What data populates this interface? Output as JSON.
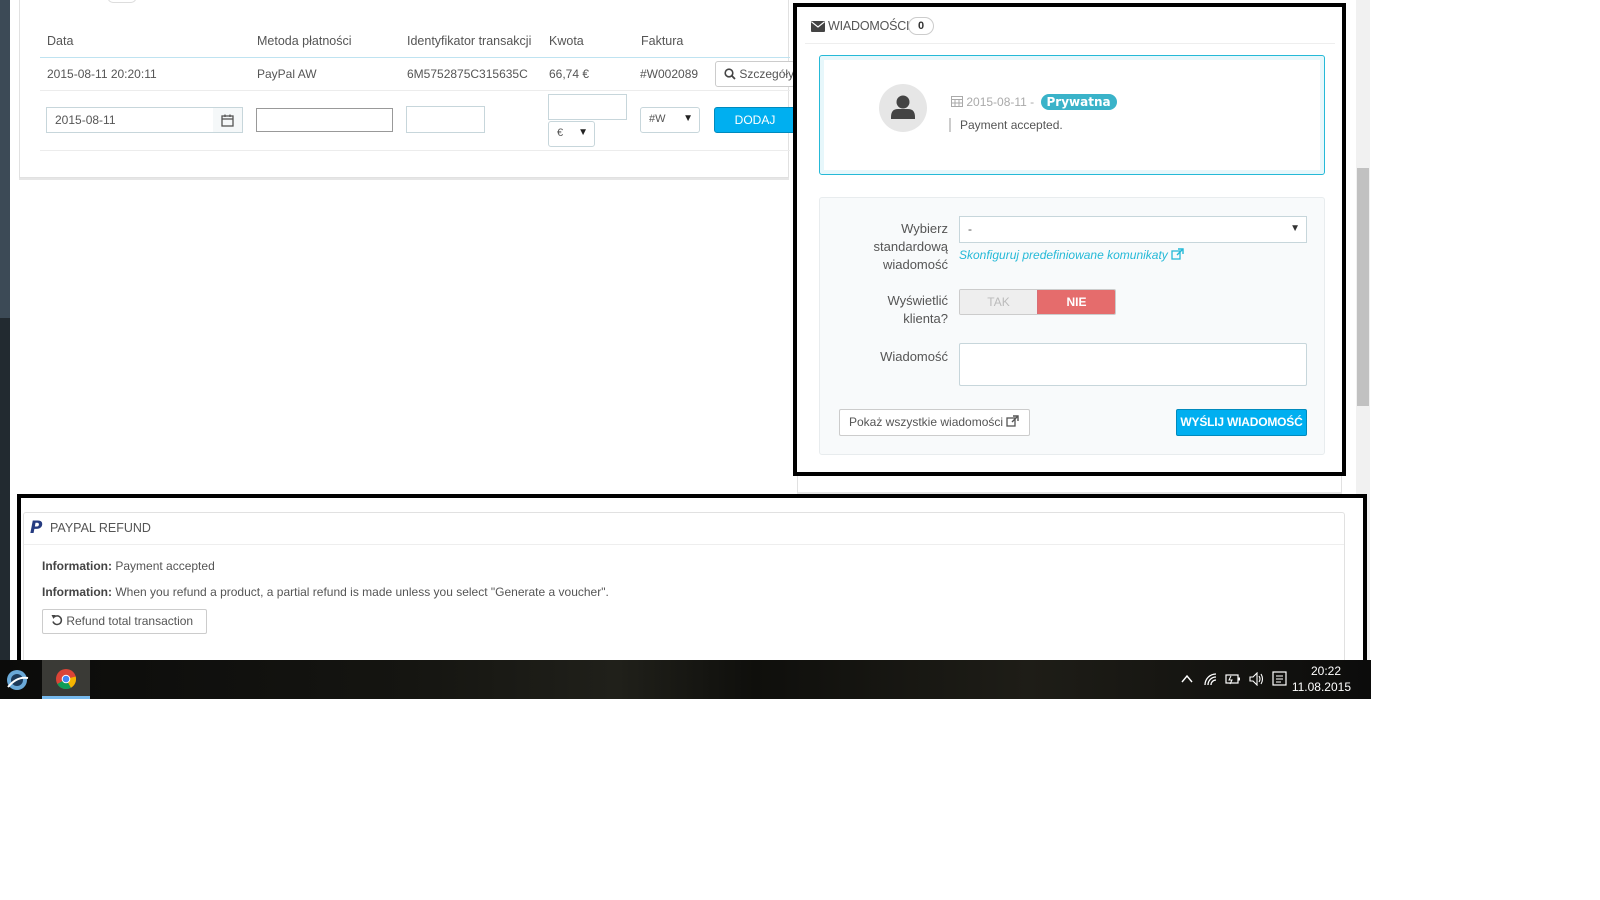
{
  "payments": {
    "headers": [
      "Data",
      "Metoda płatności",
      "Identyfikator transakcji",
      "Kwota",
      "Faktura"
    ],
    "row": {
      "date": "2015-08-11 20:20:11",
      "method": "PayPal AW",
      "transaction_id": "6M5752875C315635C",
      "amount": "66,74 €",
      "invoice": "#W002089",
      "details_label": "Szczegóły"
    },
    "form": {
      "date_value": "2015-08-11",
      "currency_value": "€",
      "invoice_value": "#W",
      "add_label": "DODAJ"
    }
  },
  "messages": {
    "title": "WIADOMOŚCI",
    "count": "0",
    "entry": {
      "date": "2015-08-11 -",
      "badge": "Prywatna",
      "text": "Payment accepted."
    },
    "form": {
      "std_label_1": "Wybierz",
      "std_label_2": "standardową",
      "std_label_3": "wiadomość",
      "std_value": "-",
      "configure_link": "Skonfiguruj predefiniowane komunikaty",
      "show_label_1": "Wyświetlić",
      "show_label_2": "klienta?",
      "toggle_yes": "TAK",
      "toggle_no": "NIE",
      "message_label": "Wiadomość",
      "show_all_label": "Pokaż wszystkie wiadomości",
      "send_label": "WYŚLIJ WIADOMOŚĆ"
    }
  },
  "paypal": {
    "title": "PAYPAL REFUND",
    "info_label": "Information:",
    "info_1": "Payment accepted",
    "info_2": "When you refund a product, a partial refund is made unless you select \"Generate a voucher\".",
    "refund_label": "Refund total transaction"
  },
  "taskbar": {
    "time": "20:22",
    "date": "11.08.2015"
  },
  "colors": {
    "accent": "#00aff0",
    "toggle_no": "#e56c6c",
    "badge": "#3ab3c9"
  }
}
